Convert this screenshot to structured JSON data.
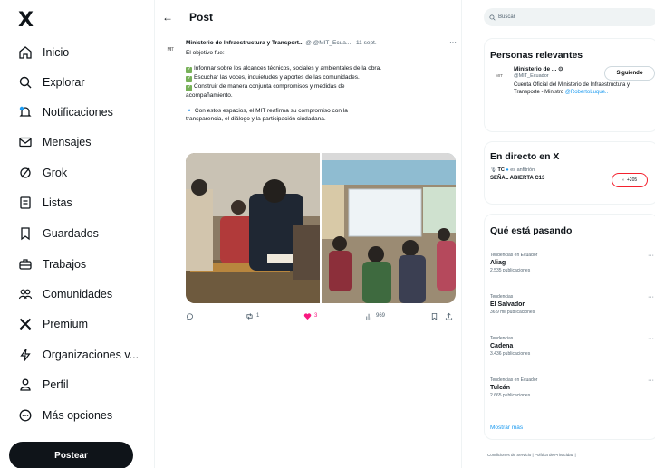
{
  "nav": {
    "logo": "X",
    "items": [
      {
        "label": "Inicio",
        "icon": "home-icon"
      },
      {
        "label": "Explorar",
        "icon": "search-icon"
      },
      {
        "label": "Notificaciones",
        "icon": "bell-icon"
      },
      {
        "label": "Mensajes",
        "icon": "envelope-icon"
      },
      {
        "label": "Grok",
        "icon": "grok-icon"
      },
      {
        "label": "Listas",
        "icon": "list-icon"
      },
      {
        "label": "Guardados",
        "icon": "bookmark-icon"
      },
      {
        "label": "Trabajos",
        "icon": "briefcase-icon"
      },
      {
        "label": "Comunidades",
        "icon": "people-icon"
      },
      {
        "label": "Premium",
        "icon": "x-premium-icon"
      },
      {
        "label": "Organizaciones v...",
        "icon": "lightning-icon"
      },
      {
        "label": "Perfil",
        "icon": "person-icon"
      },
      {
        "label": "Más opciones",
        "icon": "more-circle-icon"
      }
    ],
    "post_button": "Postear"
  },
  "center": {
    "title": "Post",
    "tweet": {
      "avatar_text": "MIT",
      "author": "Ministerio de Infraestructura y Transport...",
      "meta": "@ @MIT_Ecua... · 11 sept.",
      "lines": {
        "l1": "El objetivo fue:",
        "l2": "Informar sobre los alcances técnicos, sociales y ambientales de la obra.",
        "l3": "Escuchar las voces, inquietudes y aportes de las comunidades.",
        "l4": "Construir de manera conjunta compromisos y medidas de",
        "l5": "acompañamiento.",
        "l6": "Con estos espacios, el MIT reafirma su compromiso con la",
        "l7": "transparencia, el diálogo y la participación ciudadana."
      },
      "actions": {
        "retweets": "1",
        "likes": "3",
        "views": "969"
      }
    }
  },
  "right": {
    "search_placeholder": "Buscar",
    "relevant": {
      "title": "Personas relevantes",
      "avatar_text": "MIT",
      "name": "Ministerio de ... ⊙",
      "handle": "@MIT_Ecuador",
      "follow_label": "Siguiendo",
      "bio": "Cuenta Oficial del Ministerio de Infraestructura y Transporte - Ministro",
      "bio_link": "@RobertoLuque.."
    },
    "live": {
      "title": "En directo en X",
      "host": "TC",
      "host_suffix": "es anfitrión",
      "name": "SEÑAL ABIERTA C13",
      "badge": "+205"
    },
    "trending": {
      "title": "Qué está pasando",
      "items": [
        {
          "context": "Tendencias en Ecuador",
          "name": "Aliag",
          "count": "2.535 publicaciones"
        },
        {
          "context": "Tendencias",
          "name": "El Salvador",
          "count": "36,9 mil publicaciones"
        },
        {
          "context": "Tendencias",
          "name": "Cadena",
          "count": "3.436 publicaciones"
        },
        {
          "context": "Tendencias en Ecuador",
          "name": "Tulcán",
          "count": "2.665 publicaciones"
        }
      ],
      "show_more": "Mostrar más"
    },
    "footer": "Condiciones de Servicio  |  Política de Privacidad  |"
  },
  "colors": {
    "accent": "#1d9bf0",
    "like": "#f91880",
    "check": "#78b159",
    "live_ring": "#f4212e"
  }
}
